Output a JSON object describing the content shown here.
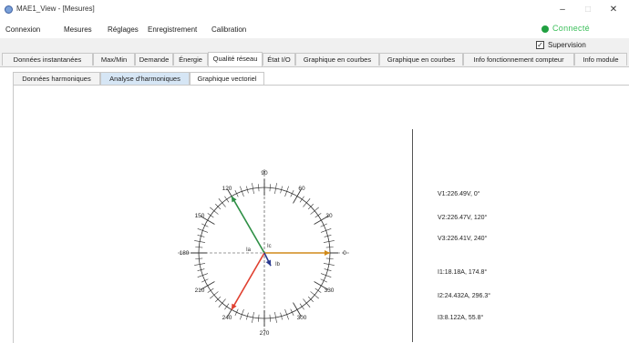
{
  "window": {
    "title": "MAE1_View - [Mesures]",
    "minimize": "–",
    "maximize": "□",
    "close": "✕"
  },
  "menu": [
    {
      "label": "Connexion"
    },
    {
      "label": "Mesures"
    },
    {
      "label": "Réglages"
    },
    {
      "label": "Enregistrement"
    },
    {
      "label": "Calibration"
    }
  ],
  "status": {
    "connection_label": "Connecté",
    "connection_color": "#20a040",
    "supervision_label": "Supervision",
    "supervision_checked": true
  },
  "tabs": [
    {
      "label": "Données instantanées"
    },
    {
      "label": "Max/Min"
    },
    {
      "label": "Demande"
    },
    {
      "label": "Énergie"
    },
    {
      "label": "Qualité réseau",
      "active": true
    },
    {
      "label": "État I/O"
    },
    {
      "label": "Graphique en courbes"
    },
    {
      "label": "Graphique en courbes"
    },
    {
      "label": "Info fonctionnement compteur"
    },
    {
      "label": "Info module"
    }
  ],
  "subtabs": [
    {
      "label": "Données harmoniques"
    },
    {
      "label": "Analyse d'harmoniques",
      "highlighted": true
    },
    {
      "label": "Graphique vectoriel",
      "active": true
    }
  ],
  "vector": {
    "dial_labels": [
      "0",
      "30",
      "60",
      "90",
      "120",
      "150",
      "180",
      "210",
      "240",
      "270",
      "300",
      "330"
    ],
    "phasor_labels": {
      "ia": "Ia",
      "ib": "Ib",
      "ic": "Ic"
    },
    "phasors": [
      {
        "name": "V1",
        "color": "#d08a1a",
        "angle_deg": 0,
        "magnitude": 1.0
      },
      {
        "name": "V2",
        "color": "#2e8f45",
        "angle_deg": 120,
        "magnitude": 1.0
      },
      {
        "name": "V3",
        "color": "#e04030",
        "angle_deg": 240,
        "magnitude": 1.0
      },
      {
        "name": "Ib",
        "color": "#2a3a90",
        "angle_deg": 296.3,
        "magnitude": 0.22
      }
    ]
  },
  "readouts": {
    "voltage": [
      "V1:226.49V, 0°",
      "V2:226.47V, 120°",
      "V3:226.41V, 240°"
    ],
    "current": [
      "I1:18.18A, 174.8°",
      "I2:24.432A, 296.3°",
      "I3:8.122A, 55.8°"
    ]
  }
}
